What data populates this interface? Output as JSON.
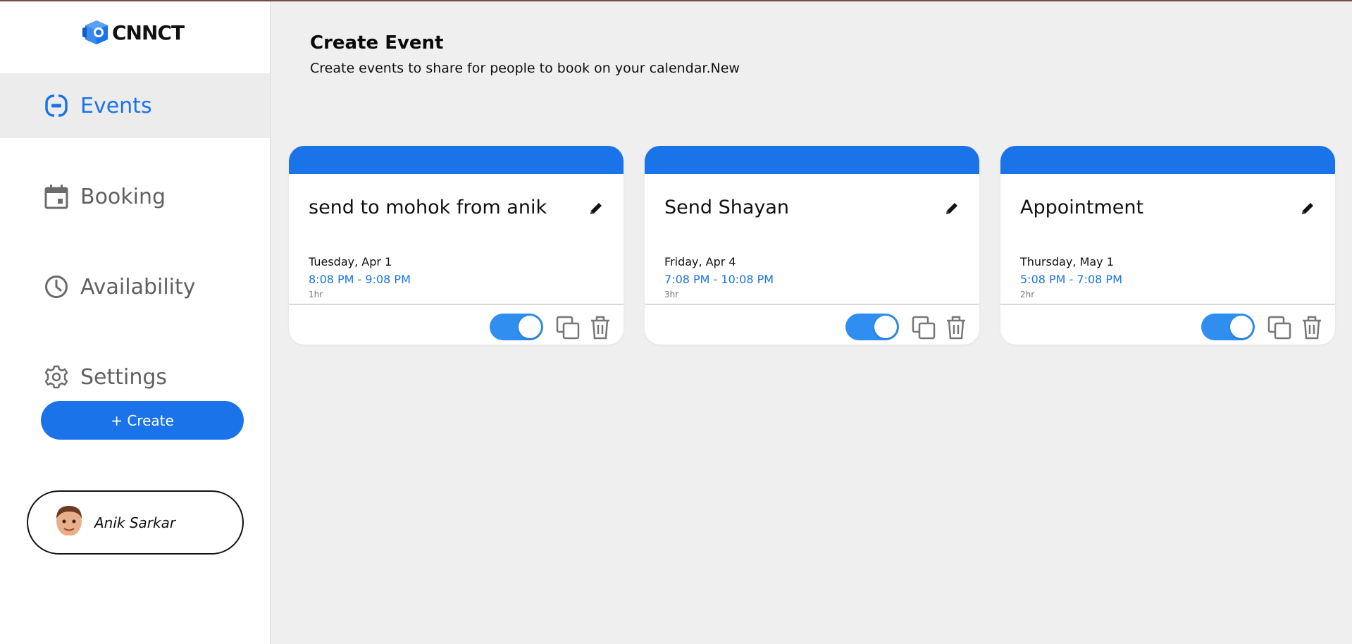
{
  "brand": {
    "name": "CNNCT",
    "logo_icon": "cube-logo-icon"
  },
  "colors": {
    "accent": "#1a73e8",
    "toggle_on": "#2f8ef0",
    "background": "#efefef"
  },
  "sidebar": {
    "items": [
      {
        "label": "Events",
        "icon": "events-icon",
        "active": true
      },
      {
        "label": "Booking",
        "icon": "calendar-icon",
        "active": false
      },
      {
        "label": "Availability",
        "icon": "clock-icon",
        "active": false
      },
      {
        "label": "Settings",
        "icon": "gear-icon",
        "active": false
      }
    ],
    "create_label": "+ Create",
    "user": {
      "name": "Anik Sarkar",
      "avatar": "avatar-memoji"
    }
  },
  "main": {
    "title": "Create Event",
    "subtitle": "Create events to share for people to book on your calendar.New",
    "events": [
      {
        "title": "send to mohok from anik",
        "date": "Tuesday, Apr 1",
        "time": "8:08 PM - 9:08 PM",
        "duration": "1hr",
        "enabled": true
      },
      {
        "title": "Send Shayan",
        "date": "Friday, Apr 4",
        "time": "7:08 PM - 10:08 PM",
        "duration": "3hr",
        "enabled": true
      },
      {
        "title": "Appointment",
        "date": "Thursday, May 1",
        "time": "5:08 PM - 7:08 PM",
        "duration": "2hr",
        "enabled": true
      }
    ]
  }
}
